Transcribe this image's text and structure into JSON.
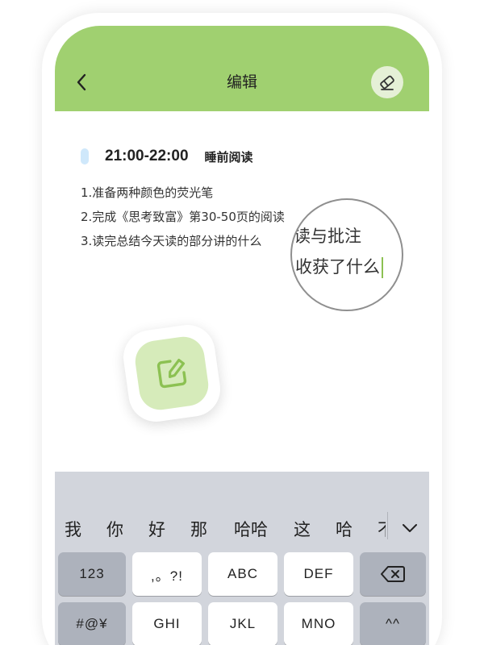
{
  "header": {
    "title": "编辑",
    "back_icon": "chevron-left-icon",
    "eraser_icon": "eraser-icon"
  },
  "entry": {
    "time": "21:00-22:00",
    "topic": "睡前阅读",
    "lines": [
      "1.准备两种颜色的荧光笔",
      "2.完成《思考致富》第30-50页的阅读",
      "3.读完总结今天读的部分讲的什么"
    ]
  },
  "magnifier": {
    "line1": "读与批注",
    "line2": "收获了什么"
  },
  "keyboard": {
    "candidates": [
      "我",
      "你",
      "好",
      "那",
      "哈哈",
      "这",
      "哈",
      "不"
    ],
    "row1": [
      "123",
      ",。?!",
      "ABC",
      "DEF"
    ],
    "row2": [
      "#@¥",
      "GHI",
      "JKL",
      "MNO",
      "^^"
    ]
  },
  "colors": {
    "header_bg": "#a0d070",
    "accent_green": "#8cc152",
    "marker_blue": "#cfe8fb",
    "keyboard_bg": "#d2d5dc"
  }
}
